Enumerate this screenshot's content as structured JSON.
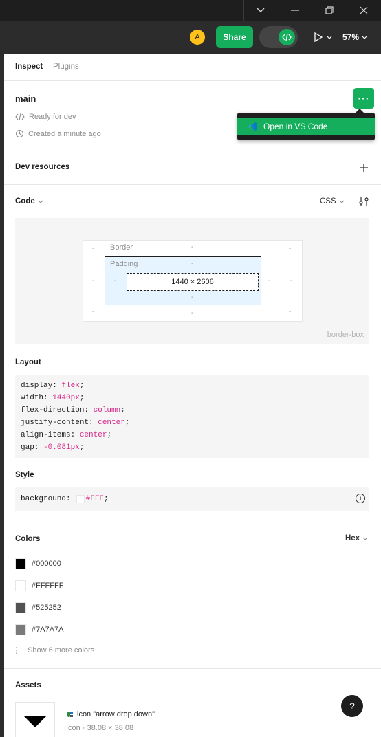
{
  "window": {
    "dropdown_icon": "chevron-down-icon",
    "minimize_icon": "minimize-icon",
    "restore_icon": "restore-icon",
    "close_icon": "close-icon"
  },
  "toolbar": {
    "avatar_initial": "A",
    "share_label": "Share",
    "zoom": "57%"
  },
  "tabs": [
    {
      "label": "Inspect",
      "active": true
    },
    {
      "label": "Plugins",
      "active": false
    }
  ],
  "node": {
    "name": "main",
    "status": "Ready for dev",
    "created": "Created a minute ago"
  },
  "dropdown_menu": {
    "item_label": "Open in VS Code"
  },
  "dev_resources": {
    "title": "Dev resources"
  },
  "code": {
    "title": "Code",
    "language": "CSS",
    "box_model": {
      "border_label": "Border",
      "padding_label": "Padding",
      "size": "1440 × 2606",
      "dash": "-",
      "caption": "border-box"
    }
  },
  "layout": {
    "title": "Layout",
    "lines": [
      {
        "prop": "display",
        "value": "flex"
      },
      {
        "prop": "width",
        "value": "1440px"
      },
      {
        "prop": "flex-direction",
        "value": "column"
      },
      {
        "prop": "justify-content",
        "value": "center"
      },
      {
        "prop": "align-items",
        "value": "center"
      },
      {
        "prop": "gap",
        "value": "-0.081px"
      }
    ]
  },
  "style": {
    "title": "Style",
    "prop": "background",
    "value": "#FFF"
  },
  "colors": {
    "title": "Colors",
    "format": "Hex",
    "items": [
      {
        "hex": "#000000",
        "swatch": "#000000"
      },
      {
        "hex": "#FFFFFF",
        "swatch": "#FFFFFF"
      },
      {
        "hex": "#525252",
        "swatch": "#525252"
      },
      {
        "hex": "#7A7A7A",
        "swatch": "#7A7A7A"
      }
    ],
    "show_more": "Show 6 more colors"
  },
  "assets": {
    "title": "Assets",
    "item_name": "icon \"arrow drop down\"",
    "item_meta": "Icon · 38.08 × 38.08"
  },
  "help": {
    "label": "?"
  },
  "accent_color": "#14AE5C"
}
